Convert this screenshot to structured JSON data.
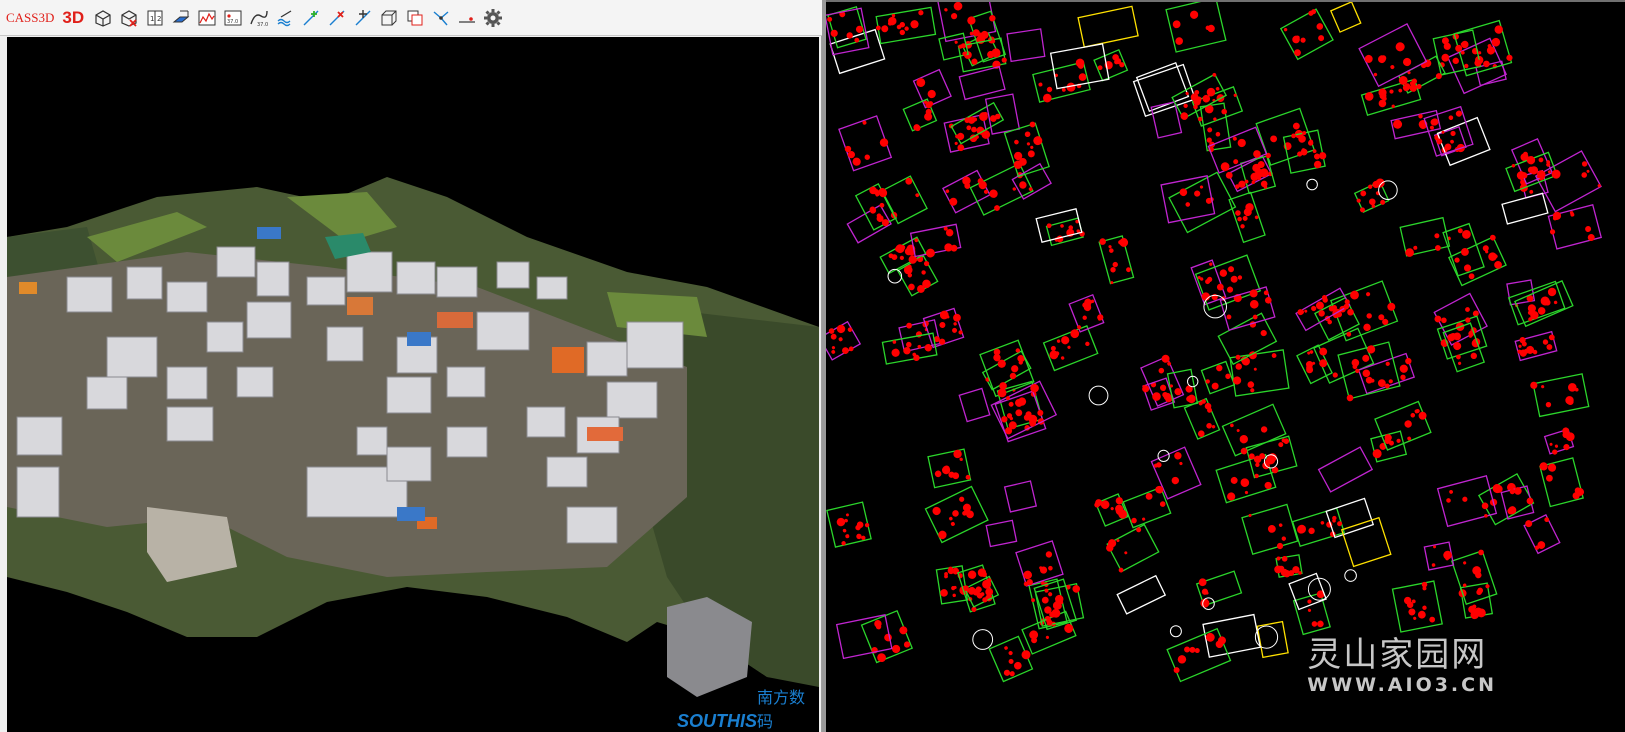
{
  "toolbar": {
    "brand_label": "CASS3D",
    "mode_label": "3D",
    "tools": [
      {
        "icon": "cube-open-icon"
      },
      {
        "icon": "cube-delete-icon"
      },
      {
        "icon": "scale-ratio-icon"
      },
      {
        "icon": "plane-fill-icon"
      },
      {
        "icon": "terrain-chart-icon"
      },
      {
        "icon": "elevation-point-icon"
      },
      {
        "icon": "contour-line-icon"
      },
      {
        "icon": "water-wave-icon"
      },
      {
        "icon": "add-point-icon"
      },
      {
        "icon": "delete-point-icon"
      },
      {
        "icon": "move-point-icon"
      },
      {
        "icon": "box-3d-icon"
      },
      {
        "icon": "layer-copy-icon"
      },
      {
        "icon": "vertex-edit-icon"
      },
      {
        "icon": "line-point-icon"
      },
      {
        "icon": "settings-gear-icon"
      }
    ]
  },
  "viewport3d": {
    "logo_en": "SOUTHIS",
    "logo_cn": "南方数码"
  },
  "cad_view": {
    "watermark_title": "灵山家园网",
    "watermark_url": "WWW.AIO3.CN"
  },
  "colors": {
    "cad_red": "#ff0000",
    "cad_green": "#2bd52b",
    "cad_magenta": "#c025d0",
    "cad_white": "#ffffff",
    "cad_yellow": "#ffe100"
  }
}
